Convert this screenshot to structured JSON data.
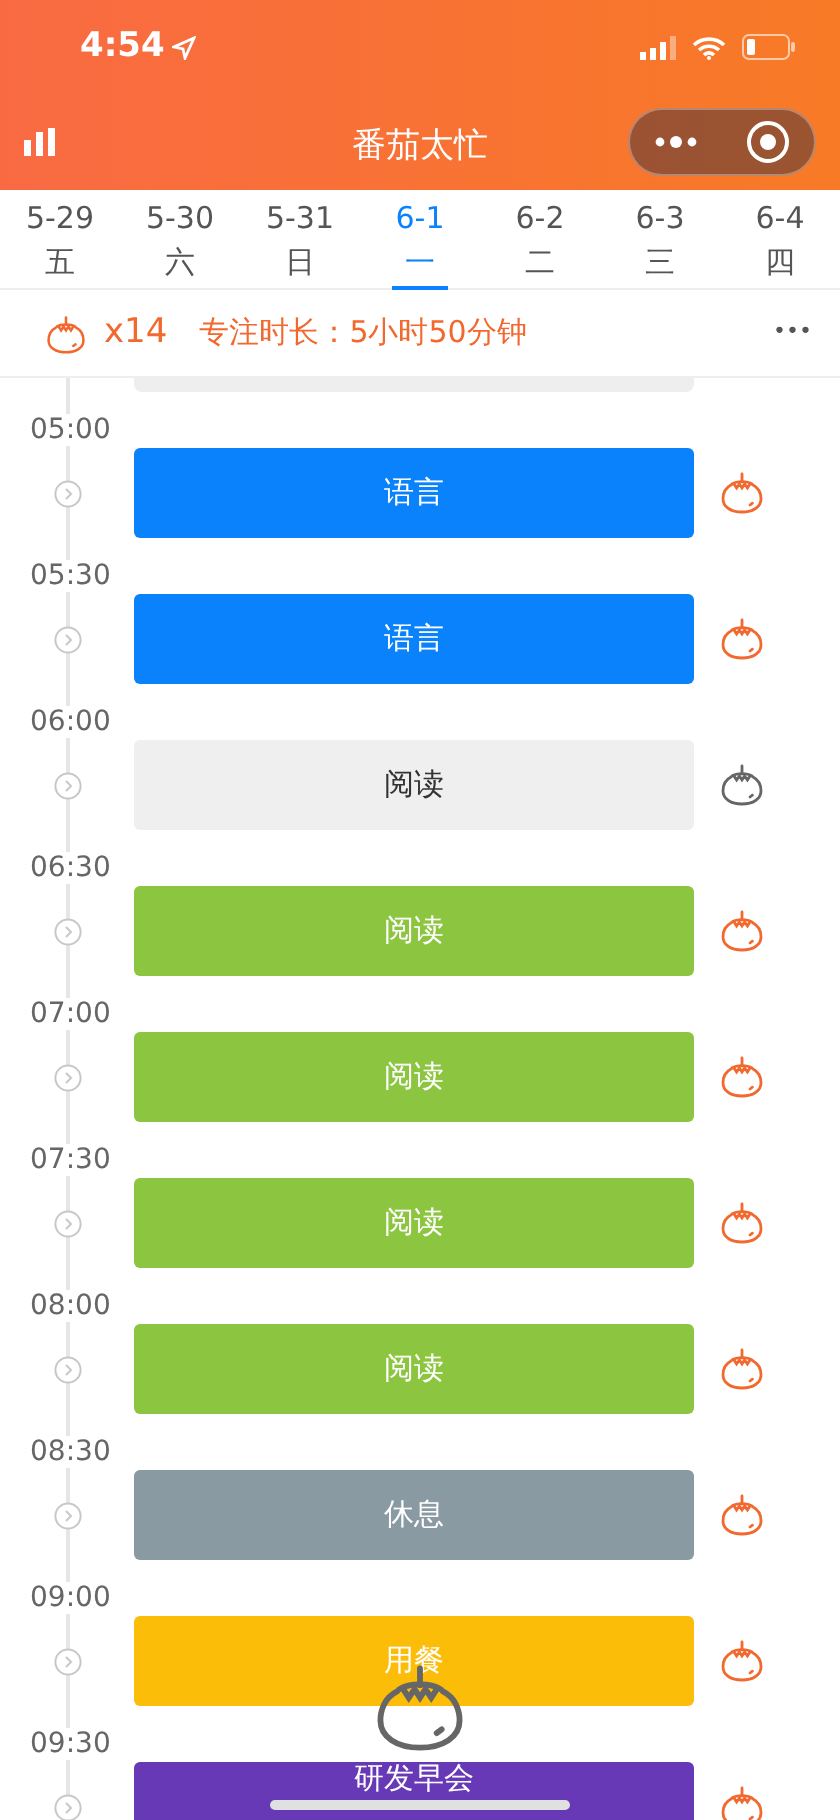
{
  "status_bar": {
    "time": "4:54"
  },
  "nav": {
    "title": "番茄太忙"
  },
  "dates": [
    {
      "date": "5-29",
      "weekday": "五",
      "selected": false
    },
    {
      "date": "5-30",
      "weekday": "六",
      "selected": false
    },
    {
      "date": "5-31",
      "weekday": "日",
      "selected": false
    },
    {
      "date": "6-1",
      "weekday": "一",
      "selected": true
    },
    {
      "date": "6-2",
      "weekday": "二",
      "selected": false
    },
    {
      "date": "6-3",
      "weekday": "三",
      "selected": false
    },
    {
      "date": "6-4",
      "weekday": "四",
      "selected": false
    }
  ],
  "summary": {
    "count": "x14",
    "focus": "专注时长：5小时50分钟",
    "more": "•••"
  },
  "cut_block": {
    "color": "#eeeeee"
  },
  "slots": [
    {
      "time": "05:00",
      "task": "语言",
      "color": "#0a82fc",
      "done": true
    },
    {
      "time": "05:30",
      "task": "语言",
      "color": "#0a82fc",
      "done": true
    },
    {
      "time": "06:00",
      "task": "阅读",
      "color": "#efefef",
      "done": false
    },
    {
      "time": "06:30",
      "task": "阅读",
      "color": "#8cc53f",
      "done": true
    },
    {
      "time": "07:00",
      "task": "阅读",
      "color": "#8cc53f",
      "done": true
    },
    {
      "time": "07:30",
      "task": "阅读",
      "color": "#8cc53f",
      "done": true
    },
    {
      "time": "08:00",
      "task": "阅读",
      "color": "#8cc53f",
      "done": true
    },
    {
      "time": "08:30",
      "task": "休息",
      "color": "#8a9aa2",
      "done": true
    },
    {
      "time": "09:00",
      "task": "用餐",
      "color": "#fbbd08",
      "done": true
    },
    {
      "time": "09:30",
      "task": "研发早会",
      "color": "#6739b6",
      "done": true
    }
  ]
}
